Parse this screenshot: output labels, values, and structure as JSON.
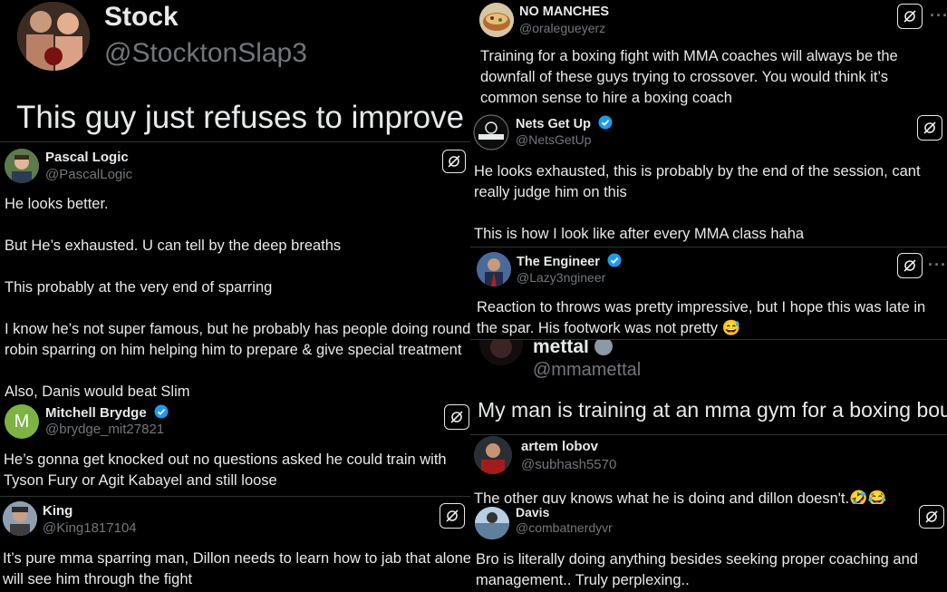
{
  "left": {
    "header": {
      "name": "Stock",
      "handle": "@StocktonSlap3",
      "text": "This guy just refuses to improve"
    },
    "tweets": [
      {
        "name": "Pascal Logic",
        "handle": "@PascalLogic",
        "verified": false,
        "text": "He looks better.\n\nBut He’s exhausted. U can tell by the deep breaths\n\nThis probably at the very end of sparring\n\nI know he’s not super famous, but he probably has people doing round robin sparring on him helping him to prepare & give special treatment\n\nAlso, Danis would beat Slim"
      },
      {
        "name": "Mitchell Brydge",
        "handle": "@brydge_mit27821",
        "avatar_letter": "M",
        "verified": true,
        "text": "He’s gonna get knocked out no questions asked he could train with Tyson Fury or Agit Kabayel and still loose"
      },
      {
        "name": "King",
        "handle": "@King1817104",
        "verified": false,
        "text": "It’s pure mma sparring man, Dillon needs to learn how to jab that alone will see him through the fight"
      }
    ]
  },
  "right": {
    "tweets": [
      {
        "name": "NO MANCHES",
        "handle": "@oralegueyerz",
        "verified": false,
        "text": "Training for a boxing fight with MMA coaches will always be the downfall of these guys trying to crossover. You would think it’s common sense to hire a boxing coach"
      },
      {
        "name": "Nets Get Up",
        "handle": "@NetsGetUp",
        "verified": true,
        "text": "He looks exhausted, this is probably by the end of the session, cant really judge him on this\n\nThis is how I look like after every MMA class haha"
      },
      {
        "name": "The Engineer",
        "handle": "@Lazy3ngineer",
        "verified": true,
        "text": "Reaction to throws was pretty impressive, but I hope this was late in the spar. His footwork was not pretty 😅"
      }
    ],
    "big": {
      "name": "mettal",
      "handle": "@mmamettal",
      "text": "My man is training at an mma gym for a boxing bout"
    },
    "tweets2": [
      {
        "name": "artem lobov",
        "handle": "@subhash5570",
        "text": "The other guy knows what he is doing and dillon doesn't.🤣😂"
      },
      {
        "name": "Davis",
        "handle": "@combatnerdyvr",
        "text": "Bro is literally doing anything besides seeking proper coaching and management.. Truly perplexing.."
      }
    ]
  },
  "more_label": "···",
  "colors": {
    "background": "#000000",
    "text": "#e7e9ea",
    "secondary": "#71767b",
    "verified": "#1d9bf0",
    "divider": "#2f3336"
  }
}
